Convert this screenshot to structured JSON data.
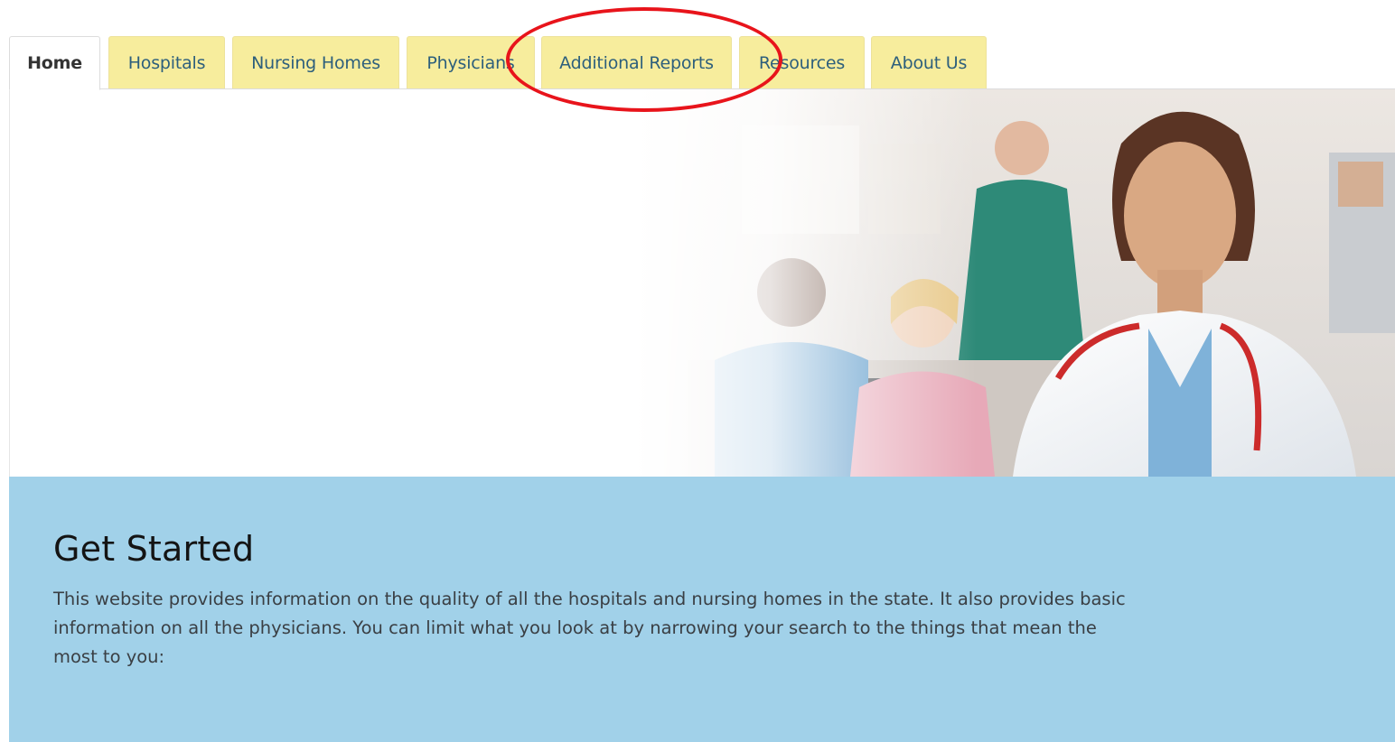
{
  "tabs": [
    {
      "label": "Home",
      "active": true
    },
    {
      "label": "Hospitals",
      "active": false
    },
    {
      "label": "Nursing Homes",
      "active": false
    },
    {
      "label": "Physicians",
      "active": false
    },
    {
      "label": "Additional Reports",
      "active": false
    },
    {
      "label": "Resources",
      "active": false
    },
    {
      "label": "About Us",
      "active": false
    }
  ],
  "hero": {
    "image": "medical-staff-photo"
  },
  "get_started": {
    "title": "Get Started",
    "description": "This website provides information on the quality of all the hospitals and nursing homes in the state. It also provides basic information on all the physicians. You can limit what you look at by narrowing your search to the things that mean the most to you:"
  },
  "colors": {
    "tab_background": "#f7ed9d",
    "tab_text": "#2d5f7c",
    "panel_background": "#a1d1e9",
    "highlight": "#e8141b"
  }
}
